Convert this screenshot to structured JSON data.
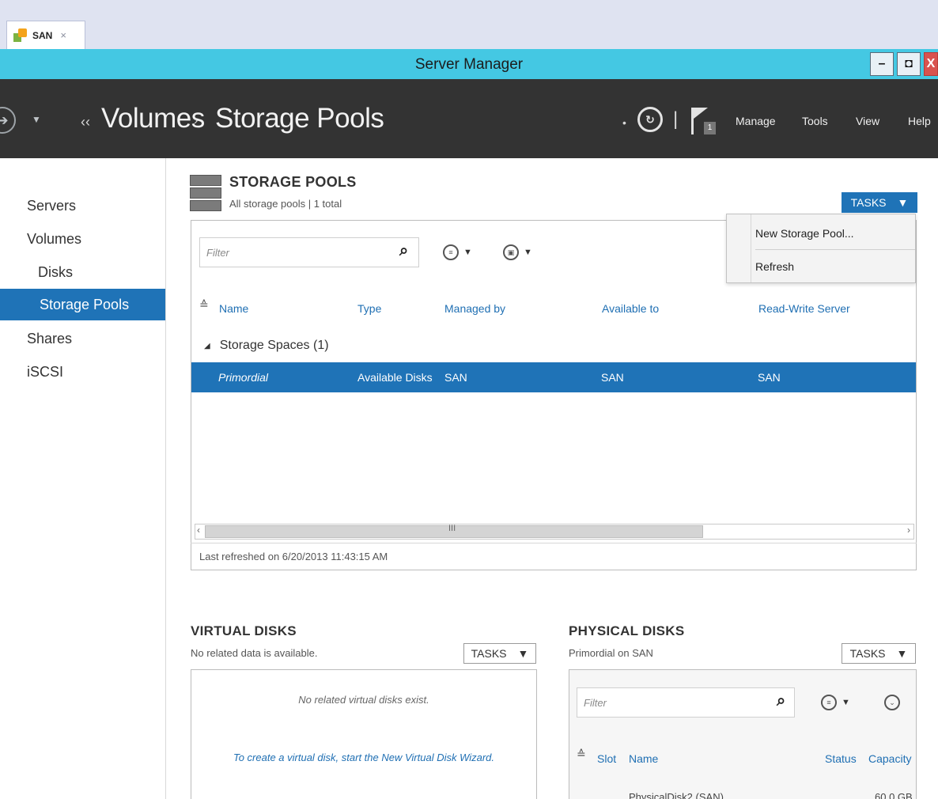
{
  "tab": {
    "label": "SAN",
    "close": "×"
  },
  "window": {
    "title": "Server Manager",
    "min": "–",
    "max": "◘",
    "close": "X"
  },
  "header": {
    "breadcrumb_sep": "‹‹",
    "breadcrumb": [
      "Volumes",
      "Storage Pools"
    ],
    "breadcrumb_arrow": "›",
    "flag_badge": "1",
    "menus": [
      "Manage",
      "Tools",
      "View",
      "Help"
    ]
  },
  "sidebar": {
    "items": [
      {
        "label": "Servers"
      },
      {
        "label": "Volumes"
      },
      {
        "label": "Disks"
      },
      {
        "label": "Storage Pools",
        "active": true
      },
      {
        "label": "Shares"
      },
      {
        "label": "iSCSI"
      }
    ]
  },
  "storage_pools": {
    "title": "STORAGE POOLS",
    "subtitle": "All storage pools | 1 total",
    "tasks": "TASKS",
    "tasks_arrow": "▼",
    "filter_placeholder": "Filter",
    "columns": [
      "Name",
      "Type",
      "Managed by",
      "Available to",
      "Read-Write Server"
    ],
    "group": "Storage Spaces (1)",
    "rows": [
      {
        "name": "Primordial",
        "type": "Available Disks",
        "managed_by": "SAN",
        "available_to": "SAN",
        "rw_server": "SAN"
      }
    ],
    "last_refreshed": "Last refreshed on 6/20/2013 11:43:15 AM",
    "scroll_grip": "III",
    "dropdown": [
      "New Storage Pool...",
      "Refresh"
    ]
  },
  "virtual_disks": {
    "title": "VIRTUAL DISKS",
    "subtitle": "No related data is available.",
    "tasks": "TASKS",
    "empty_msg": "No related virtual disks exist.",
    "wizard_link": "To create a virtual disk, start the New Virtual Disk Wizard."
  },
  "physical_disks": {
    "title": "PHYSICAL DISKS",
    "subtitle": "Primordial on SAN",
    "tasks": "TASKS",
    "filter_placeholder": "Filter",
    "columns": [
      "Slot",
      "Name",
      "Status",
      "Capacity"
    ],
    "rows": [
      {
        "name": "PhysicalDisk2 (SAN)",
        "capacity": "60.0 GB"
      }
    ]
  },
  "colors": {
    "accent": "#1f73b7",
    "titlebar": "#44c8e3",
    "header": "#333333"
  }
}
